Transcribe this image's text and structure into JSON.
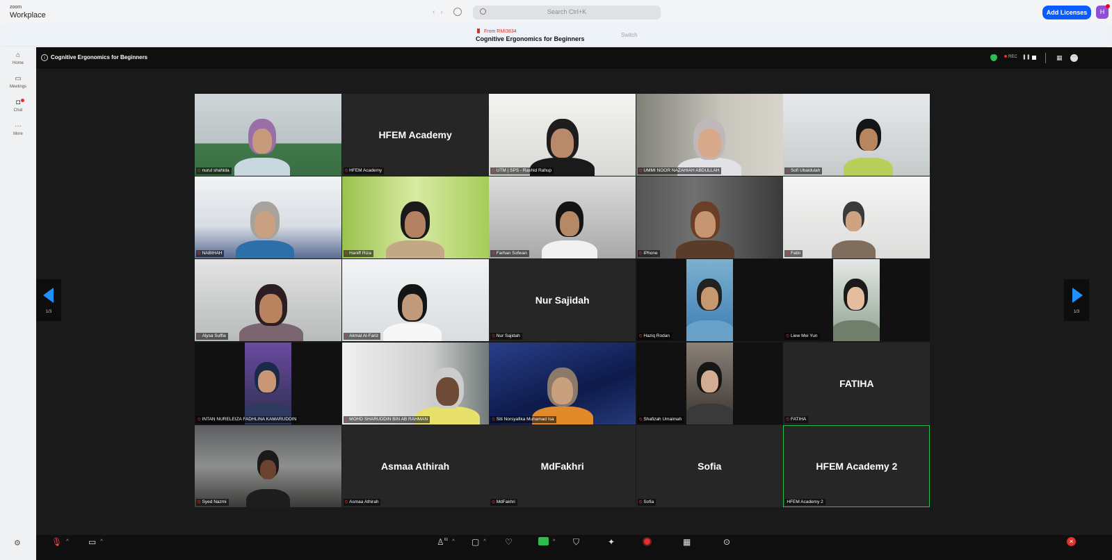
{
  "app": {
    "brand_small": "zoom",
    "brand_big": "Workplace"
  },
  "search": {
    "placeholder": "Search Ctrl+K"
  },
  "header": {
    "add_licenses": "Add Licenses",
    "avatar_letter": "H"
  },
  "notification": {
    "from": "From RMI3834",
    "title": "Cognitive Ergonomics for Beginners",
    "switch": "Switch"
  },
  "leftnav": {
    "home": "Home",
    "meetings": "Meetings",
    "chat": "Chat",
    "more": "More"
  },
  "meeting": {
    "title": "Cognitive Ergonomics for Beginners",
    "rec": "REC",
    "page_indicator": "1/3"
  },
  "participants": [
    {
      "name": "nurul shahida",
      "video": true
    },
    {
      "name": "HFEM Academy",
      "video": false,
      "display": "HFEM Academy"
    },
    {
      "name": "UTM | SPS - Rashid Rahup",
      "video": true
    },
    {
      "name": "UMMI NOOR NAZAHIAH ABDULLAH",
      "video": true
    },
    {
      "name": "Sofi Ubaidulah",
      "video": true
    },
    {
      "name": "NABIHAH",
      "video": true
    },
    {
      "name": "Haniff Riza",
      "video": true
    },
    {
      "name": "Farhan Sofwan",
      "video": true
    },
    {
      "name": "iPhone",
      "video": true
    },
    {
      "name": "Fatin",
      "video": true
    },
    {
      "name": "Alysa Suffia",
      "video": true
    },
    {
      "name": "Akmal Al-Fariz",
      "video": true
    },
    {
      "name": "Nur Sajidah",
      "video": false,
      "display": "Nur Sajidah"
    },
    {
      "name": "Haziq Rodan",
      "video": true
    },
    {
      "name": "Liew Mei Yun",
      "video": true
    },
    {
      "name": "INTAN NURELEIZA FADHLINA KAMARUDDIN",
      "video": true
    },
    {
      "name": "MOHD SHARUDDIN BIN AB RAHMAN",
      "video": true
    },
    {
      "name": "Siti Norsyafika Muhamad Isa",
      "video": true
    },
    {
      "name": "Shafizah Umaimah",
      "video": true
    },
    {
      "name": "FATIHA",
      "video": false,
      "display": "FATIHA"
    },
    {
      "name": "Syed Nazmi",
      "video": true
    },
    {
      "name": "Asmaa Athirah",
      "video": false,
      "display": "Asmaa Athirah"
    },
    {
      "name": "MdFakhri",
      "video": false,
      "display": "MdFakhri"
    },
    {
      "name": "Sofia",
      "video": false,
      "display": "Sofia"
    },
    {
      "name": "HFEM Academy 2",
      "video": false,
      "display": "HFEM Academy 2",
      "active": true,
      "unmuted": true
    }
  ],
  "toolbar": {
    "participant_count": "61"
  }
}
